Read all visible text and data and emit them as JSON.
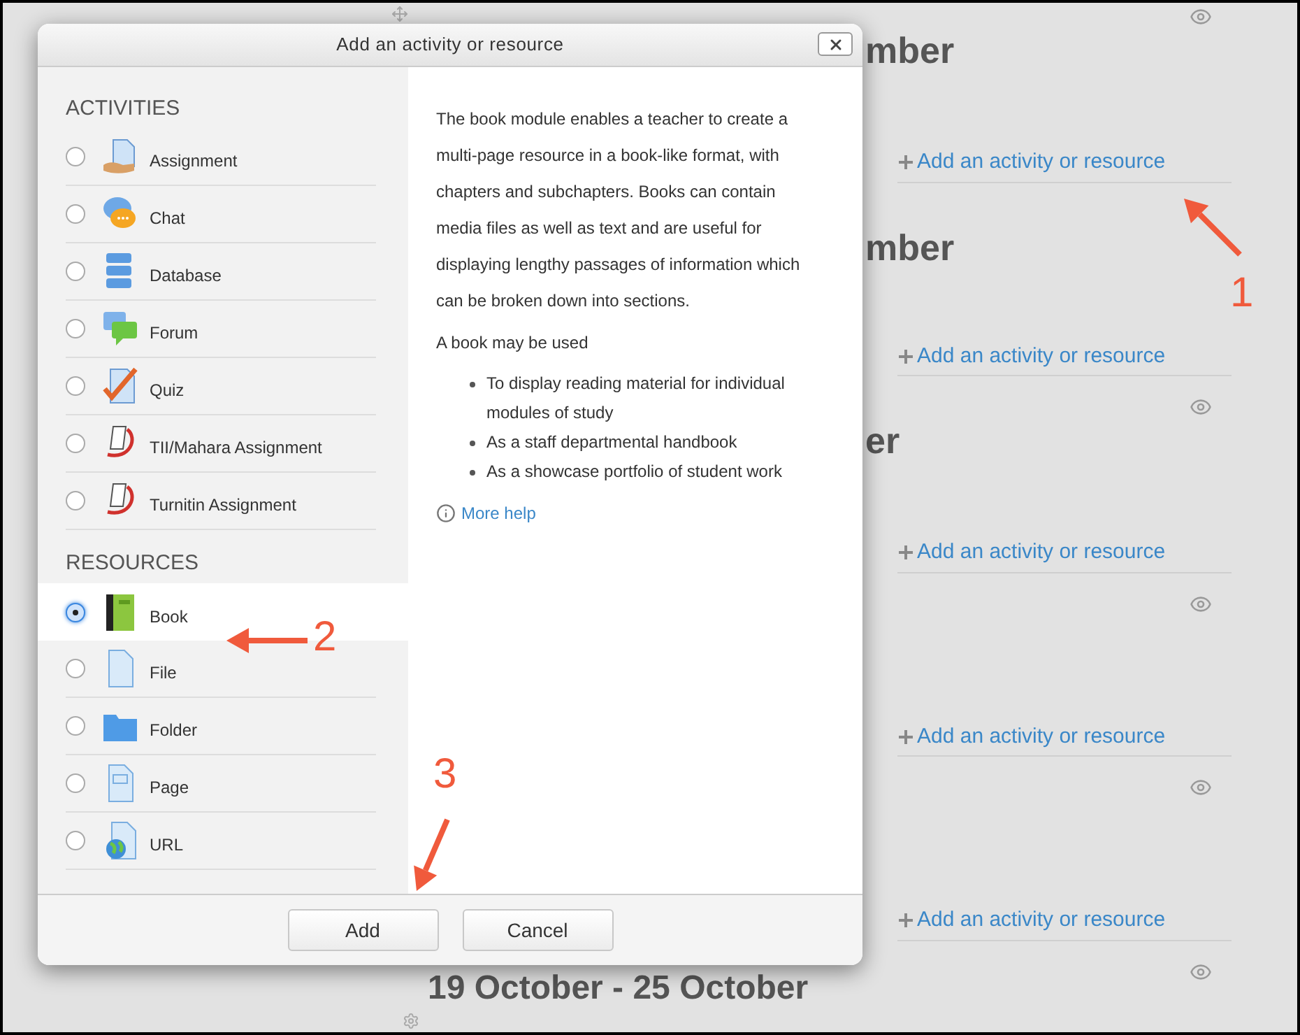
{
  "course": [
    {
      "kind": "eye"
    },
    {
      "kind": "heading",
      "text": "mber"
    },
    {
      "kind": "link",
      "text": "Add an activity or resource"
    },
    {
      "kind": "heading",
      "text": "mber"
    },
    {
      "kind": "link",
      "text": "Add an activity or resource"
    },
    {
      "kind": "eye"
    },
    {
      "kind": "heading",
      "text": "er"
    },
    {
      "kind": "link",
      "text": "Add an activity or resource"
    },
    {
      "kind": "eye"
    },
    {
      "kind": "link",
      "text": "Add an activity or resource"
    },
    {
      "kind": "eye"
    },
    {
      "kind": "link",
      "text": "Add an activity or resource"
    },
    {
      "kind": "eye"
    }
  ],
  "bottom_heading": "19 October - 25 October",
  "dialog": {
    "title": "Add an activity or resource",
    "sections": [
      {
        "heading": "ACTIVITIES",
        "items": [
          {
            "label": "Assignment",
            "selected": false
          },
          {
            "label": "Chat",
            "selected": false
          },
          {
            "label": "Database",
            "selected": false
          },
          {
            "label": "Forum",
            "selected": false
          },
          {
            "label": "Quiz",
            "selected": false
          },
          {
            "label": "TII/Mahara Assignment",
            "selected": false
          },
          {
            "label": "Turnitin Assignment",
            "selected": false
          }
        ]
      },
      {
        "heading": "RESOURCES",
        "items": [
          {
            "label": "Book",
            "selected": true
          },
          {
            "label": "File",
            "selected": false
          },
          {
            "label": "Folder",
            "selected": false
          },
          {
            "label": "Page",
            "selected": false
          },
          {
            "label": "URL",
            "selected": false
          }
        ]
      }
    ],
    "description": {
      "paragraphs": [
        "The book module enables a teacher to create a multi-page resource in a book-like format, with chapters and subchapters. Books can contain media files as well as text and are useful for displaying lengthy passages of information which can be broken down into sections.",
        "A book may be used"
      ],
      "bullets": [
        "To display reading material for individual modules of study",
        "As a staff departmental handbook",
        "As a showcase portfolio of student work"
      ],
      "help_link": "More help"
    },
    "buttons": [
      "Add",
      "Cancel"
    ]
  },
  "annotations": [
    "1",
    "2",
    "3"
  ]
}
